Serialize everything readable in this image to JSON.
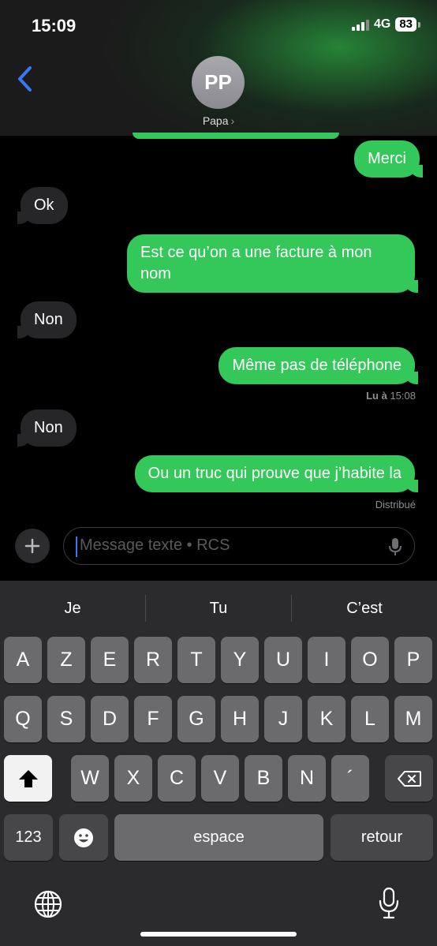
{
  "status": {
    "time": "15:09",
    "network": "4G",
    "battery": "83"
  },
  "contact": {
    "initials": "PP",
    "name": "Papa"
  },
  "messages": [
    {
      "text": "Merci",
      "dir": "out"
    },
    {
      "text": "Ok",
      "dir": "in"
    },
    {
      "text": "Est ce qu’on a une facture à mon nom",
      "dir": "out"
    },
    {
      "text": "Non",
      "dir": "in"
    },
    {
      "text": "Même pas de téléphone",
      "dir": "out"
    },
    {
      "text": "Non",
      "dir": "in"
    },
    {
      "text": "Ou un truc qui prouve que j’habite la",
      "dir": "out"
    }
  ],
  "read_receipt": {
    "label": "Lu à",
    "time": "15:08"
  },
  "delivered": "Distribué",
  "composer": {
    "placeholder": "Message texte • RCS"
  },
  "suggestions": [
    "Je",
    "Tu",
    "C’est"
  ],
  "keys": {
    "row1": [
      "A",
      "Z",
      "E",
      "R",
      "T",
      "Y",
      "U",
      "I",
      "O",
      "P"
    ],
    "row2": [
      "Q",
      "S",
      "D",
      "F",
      "G",
      "H",
      "J",
      "K",
      "L",
      "M"
    ],
    "row3": [
      "W",
      "X",
      "C",
      "V",
      "B",
      "N",
      "´"
    ],
    "numbers": "123",
    "space": "espace",
    "return": "retour"
  },
  "icons": {
    "back": "chevron-left-icon",
    "plus": "plus-icon",
    "mic": "microphone-icon",
    "shift": "shift-icon",
    "delete": "backspace-icon",
    "emoji": "emoji-icon",
    "globe": "globe-icon",
    "dictation": "microphone-icon"
  },
  "colors": {
    "outgoing": "#34c759",
    "incoming": "#262628",
    "accent": "#3478f6"
  }
}
